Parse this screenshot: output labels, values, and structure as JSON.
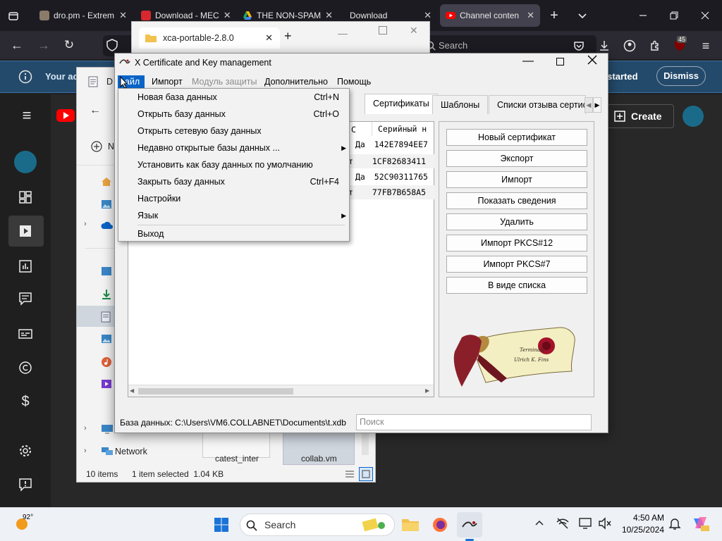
{
  "browser": {
    "tabs": [
      {
        "title": "dro.pm - Extrem",
        "favicon": "dropm-icon",
        "color": "#8a7a6a"
      },
      {
        "title": "Download - MEC",
        "favicon": "mega-icon",
        "color": "#d9272e"
      },
      {
        "title": "THE NON-SPAM",
        "favicon": "drive-icon",
        "color": "#1fa463"
      },
      {
        "title": "Download",
        "favicon": "blank-icon",
        "color": "#2b2a33"
      },
      {
        "title": "Channel conten",
        "favicon": "youtube-icon",
        "color": "#ff0000"
      }
    ],
    "search_placeholder": "Search",
    "extension_badge": "45"
  },
  "banner": {
    "text": "Your ac",
    "get_started": "et started",
    "dismiss": "Dismiss"
  },
  "youtube": {
    "create_label": "Create"
  },
  "explorer_behind": {
    "tab_title": "xca-portable-2.8.0",
    "add_tab": "+"
  },
  "explorer": {
    "address_fragment": "D",
    "new_fragment": "N",
    "network_label": "Network",
    "items_count": "10 items",
    "selection_info": "1 item selected  1.04 KB",
    "files": [
      {
        "name": "catest_inter"
      },
      {
        "name": "collab.vm"
      }
    ]
  },
  "xca": {
    "title": "X Certificate and Key management",
    "menu": {
      "file": "Файл",
      "file_visible": "айл",
      "import": "Импорт",
      "security_module": "Модуль защиты",
      "extra": "Дополнительно",
      "help": "Помощь"
    },
    "tabs": [
      "Сертификаты",
      "Шаблоны",
      "Списки отзыва сертис"
    ],
    "tab_fragment": "а",
    "columns": {
      "col_fragment": "С",
      "serial": "Серийный н"
    },
    "rows": [
      {
        "flag": "Да",
        "serial": "142E7894EE7"
      },
      {
        "flag": "т",
        "serial": "1CF82683411"
      },
      {
        "flag": "Да",
        "serial": "52C90311765"
      },
      {
        "flag": "т",
        "serial": "77FB7B658A5"
      }
    ],
    "buttons": [
      "Новый сертификат",
      "Экспорт",
      "Импорт",
      "Показать сведения",
      "Удалить",
      "Импорт PKCS#12",
      "Импорт PKCS#7",
      "В виде списка"
    ],
    "status_db": "База данных: C:\\Users\\VM6.COLLABNET\\Documents\\t.xdb",
    "search_placeholder": "Поиск"
  },
  "file_menu": {
    "items": [
      {
        "label": "Новая база данных",
        "shortcut": "Ctrl+N"
      },
      {
        "label": "Открыть базу данных",
        "shortcut": "Ctrl+O"
      },
      {
        "label": "Открыть сетевую базу данных",
        "shortcut": ""
      },
      {
        "label": "Недавно открытые базы данных ...",
        "shortcut": "",
        "submenu": true
      },
      {
        "label": "Установить как базу данных по умолчанию",
        "shortcut": ""
      },
      {
        "label": "Закрыть базу данных",
        "shortcut": "Ctrl+F4"
      },
      {
        "label": "Настройки",
        "shortcut": ""
      },
      {
        "label": "Язык",
        "shortcut": "",
        "submenu": true
      },
      {
        "label": "Выход",
        "shortcut": ""
      }
    ]
  },
  "taskbar": {
    "weather_temp": "92°",
    "search_label": "Search",
    "time": "4:50 AM",
    "date": "10/25/2024"
  },
  "colors": {
    "menu_highlight": "#0a64c8",
    "youtube_red": "#ff0000",
    "banner_bg": "#244a6b"
  }
}
